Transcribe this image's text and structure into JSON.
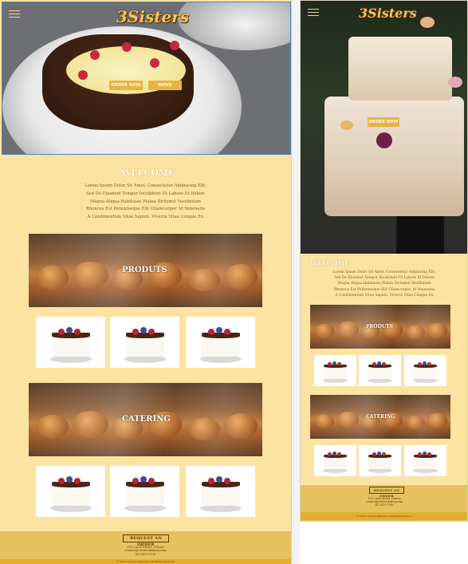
{
  "desktop": {
    "logo": "3Sisters",
    "hero_buttons": {
      "order": "ORDER NOW",
      "menu": "MENU"
    },
    "welcome": {
      "title": "WELCOME",
      "lines": [
        "Lorem Ipsum Dolor Sit Amet, Consectetur Adipiscing Elit,",
        "Sed Do Eiusmod Tempor Incididunt Ut Labore Et Dolore",
        "Magna Aliqua.Habitasse Platea Dictumst Vestibulum",
        "Rhoncus Est Pellentesque Elit Ullamcorper. Id Venenatis",
        "A Condimentum Vitae Sapien. Viverra Vitae Congue Eu"
      ]
    },
    "products_label": "PRODUTS",
    "catering_label": "CATERING",
    "request_button": "REQUEST AN ORDER",
    "address": [
      "1911 Arch Street, Ottawa",
      "contact@3sistersbakery.com",
      "613-425-1190"
    ],
    "copyright": "© 2024 3 Sisters Bakeries | All Rights Reserved"
  },
  "mobile": {
    "logo": "3Sisters",
    "hero_button": "ORDER NOW",
    "welcome": {
      "title": "WELCOME",
      "lines": [
        "Lorem Ipsum Dolor Sit Amet, Consectetur Adipiscing Elit,",
        "Sed Do Eiusmod Tempor Incididunt Ut Labore Et Dolore",
        "Magna Aliqua.Habitasse Platea Dictumst Vestibulum",
        "Rhoncus Est Pellentesque Elit Ullamcorper. Id Venenatis",
        "A Condimentum Vitae Sapien. Viverra Vitae Congue Eu"
      ]
    },
    "products_label": "PRODUTS",
    "catering_label": "CATERING",
    "request_button": "REQUEST AN ORDER",
    "address": [
      "1911 Arch Street, Ottawa",
      "contact@3sistersbakery.com",
      "613-425-1190"
    ],
    "copyright": "© 2024 3 Sisters Bakeries | All Rights Reserved"
  },
  "colors": {
    "cream": "#fde3a2",
    "gold": "#e9b33f",
    "gold_dark": "#e6c15e",
    "footer_bar": "#e2ae2f",
    "divider": "#f2f2f2"
  }
}
